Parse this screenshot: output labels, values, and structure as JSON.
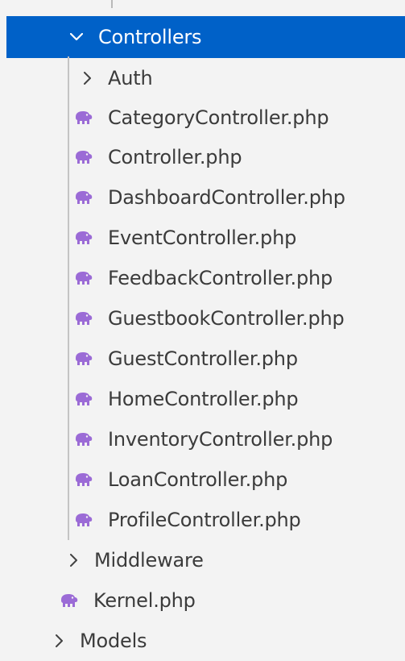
{
  "explorer": {
    "selected_folder": "Controllers",
    "items": [
      {
        "label": "Auth"
      },
      {
        "label": "CategoryController.php"
      },
      {
        "label": "Controller.php"
      },
      {
        "label": "DashboardController.php"
      },
      {
        "label": "EventController.php"
      },
      {
        "label": "FeedbackController.php"
      },
      {
        "label": "GuestbookController.php"
      },
      {
        "label": "GuestController.php"
      },
      {
        "label": "HomeController.php"
      },
      {
        "label": "InventoryController.php"
      },
      {
        "label": "LoanController.php"
      },
      {
        "label": "ProfileController.php"
      }
    ],
    "siblings": [
      {
        "label": "Middleware"
      },
      {
        "label": "Kernel.php"
      }
    ],
    "outer": [
      {
        "label": "Models"
      }
    ]
  },
  "icons": {
    "folder_expanded": "chevron-down-icon",
    "folder_collapsed": "chevron-right-icon",
    "php_file": "php-elephant-icon"
  },
  "colors": {
    "selection": "#0061c8",
    "sidebar_bg": "#f3f3f3",
    "text": "#3b3b3b",
    "php_icon": "#9b6bd6",
    "guide": "#c4c4c4"
  }
}
